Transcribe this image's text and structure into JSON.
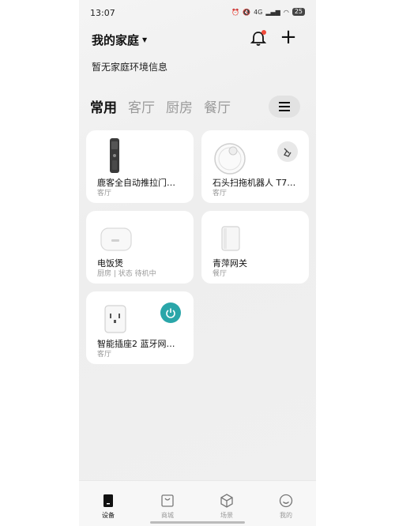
{
  "status_bar": {
    "time": "13:07",
    "network": "4G",
    "battery": "25"
  },
  "header": {
    "home_name": "我的家庭",
    "env_info": "暂无家庭环境信息"
  },
  "tabs": [
    {
      "label": "常用",
      "active": true
    },
    {
      "label": "客厅",
      "active": false
    },
    {
      "label": "厨房",
      "active": false
    },
    {
      "label": "餐厅",
      "active": false
    }
  ],
  "devices": [
    {
      "name": "鹿客全自动推拉门…",
      "room": "客厅",
      "icon": "smart-lock-icon"
    },
    {
      "name": "石头扫拖机器人 T7…",
      "room": "客厅",
      "icon": "robot-vacuum-icon",
      "action_icon": "sweep-icon"
    },
    {
      "name": "电饭煲",
      "room": "厨房 | 状态 待机中",
      "icon": "rice-cooker-icon"
    },
    {
      "name": "青萍网关",
      "room": "餐厅",
      "icon": "gateway-icon"
    },
    {
      "name": "智能插座2 蓝牙网…",
      "room": "客厅",
      "icon": "smart-plug-icon",
      "action_icon": "power-icon"
    }
  ],
  "bottom_nav": [
    {
      "label": "设备",
      "icon": "device-icon",
      "active": true
    },
    {
      "label": "商城",
      "icon": "store-icon",
      "active": false
    },
    {
      "label": "场景",
      "icon": "scene-icon",
      "active": false
    },
    {
      "label": "我的",
      "icon": "profile-icon",
      "active": false
    }
  ],
  "colors": {
    "accent": "#2aa6a9",
    "badge": "#f04a3a"
  }
}
